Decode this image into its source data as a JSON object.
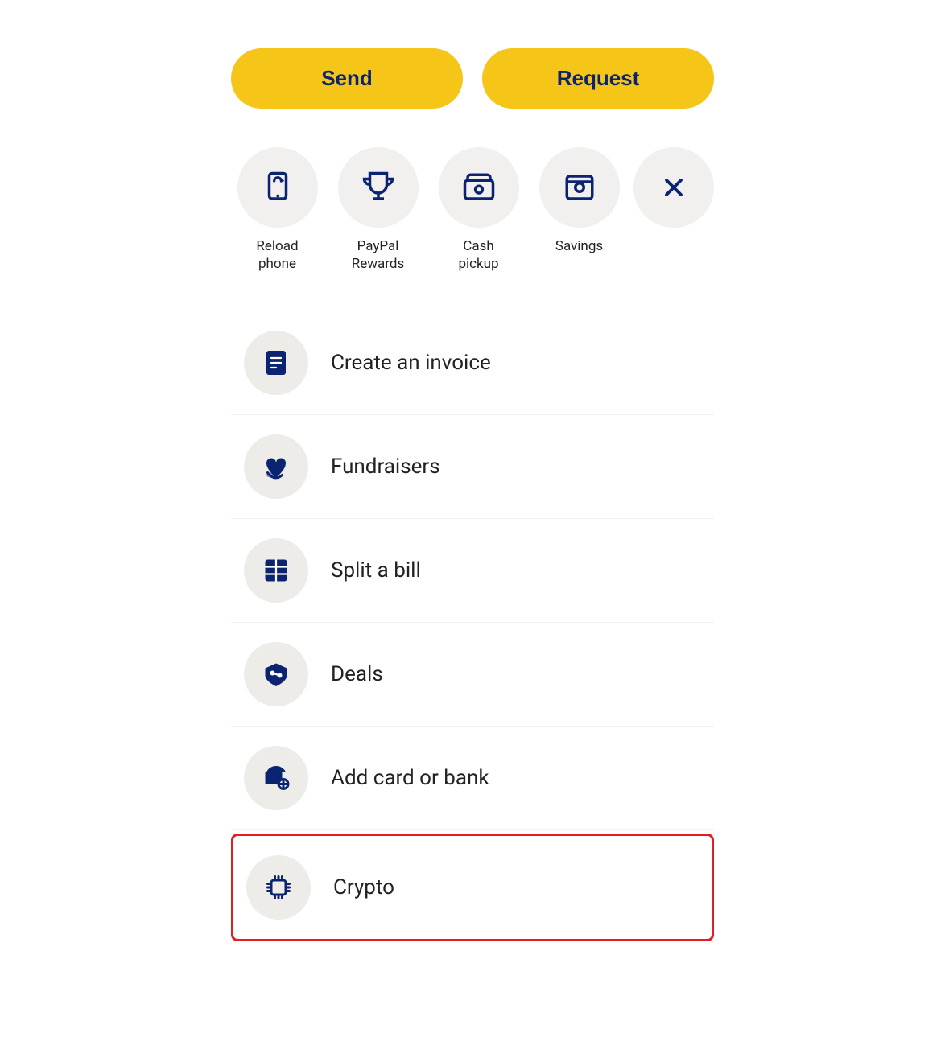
{
  "buttons": {
    "send_label": "Send",
    "request_label": "Request"
  },
  "quick_actions": [
    {
      "id": "reload-phone",
      "label": "Reload\nphone"
    },
    {
      "id": "paypal-rewards",
      "label": "PayPal\nRewards"
    },
    {
      "id": "cash-pickup",
      "label": "Cash\npickup"
    },
    {
      "id": "savings",
      "label": "Savings"
    },
    {
      "id": "close",
      "label": ""
    }
  ],
  "list_items": [
    {
      "id": "create-invoice",
      "label": "Create an invoice",
      "highlighted": false
    },
    {
      "id": "fundraisers",
      "label": "Fundraisers",
      "highlighted": false
    },
    {
      "id": "split-bill",
      "label": "Split a bill",
      "highlighted": false
    },
    {
      "id": "deals",
      "label": "Deals",
      "highlighted": false
    },
    {
      "id": "add-card-bank",
      "label": "Add card or bank",
      "highlighted": false
    },
    {
      "id": "crypto",
      "label": "Crypto",
      "highlighted": true
    }
  ]
}
